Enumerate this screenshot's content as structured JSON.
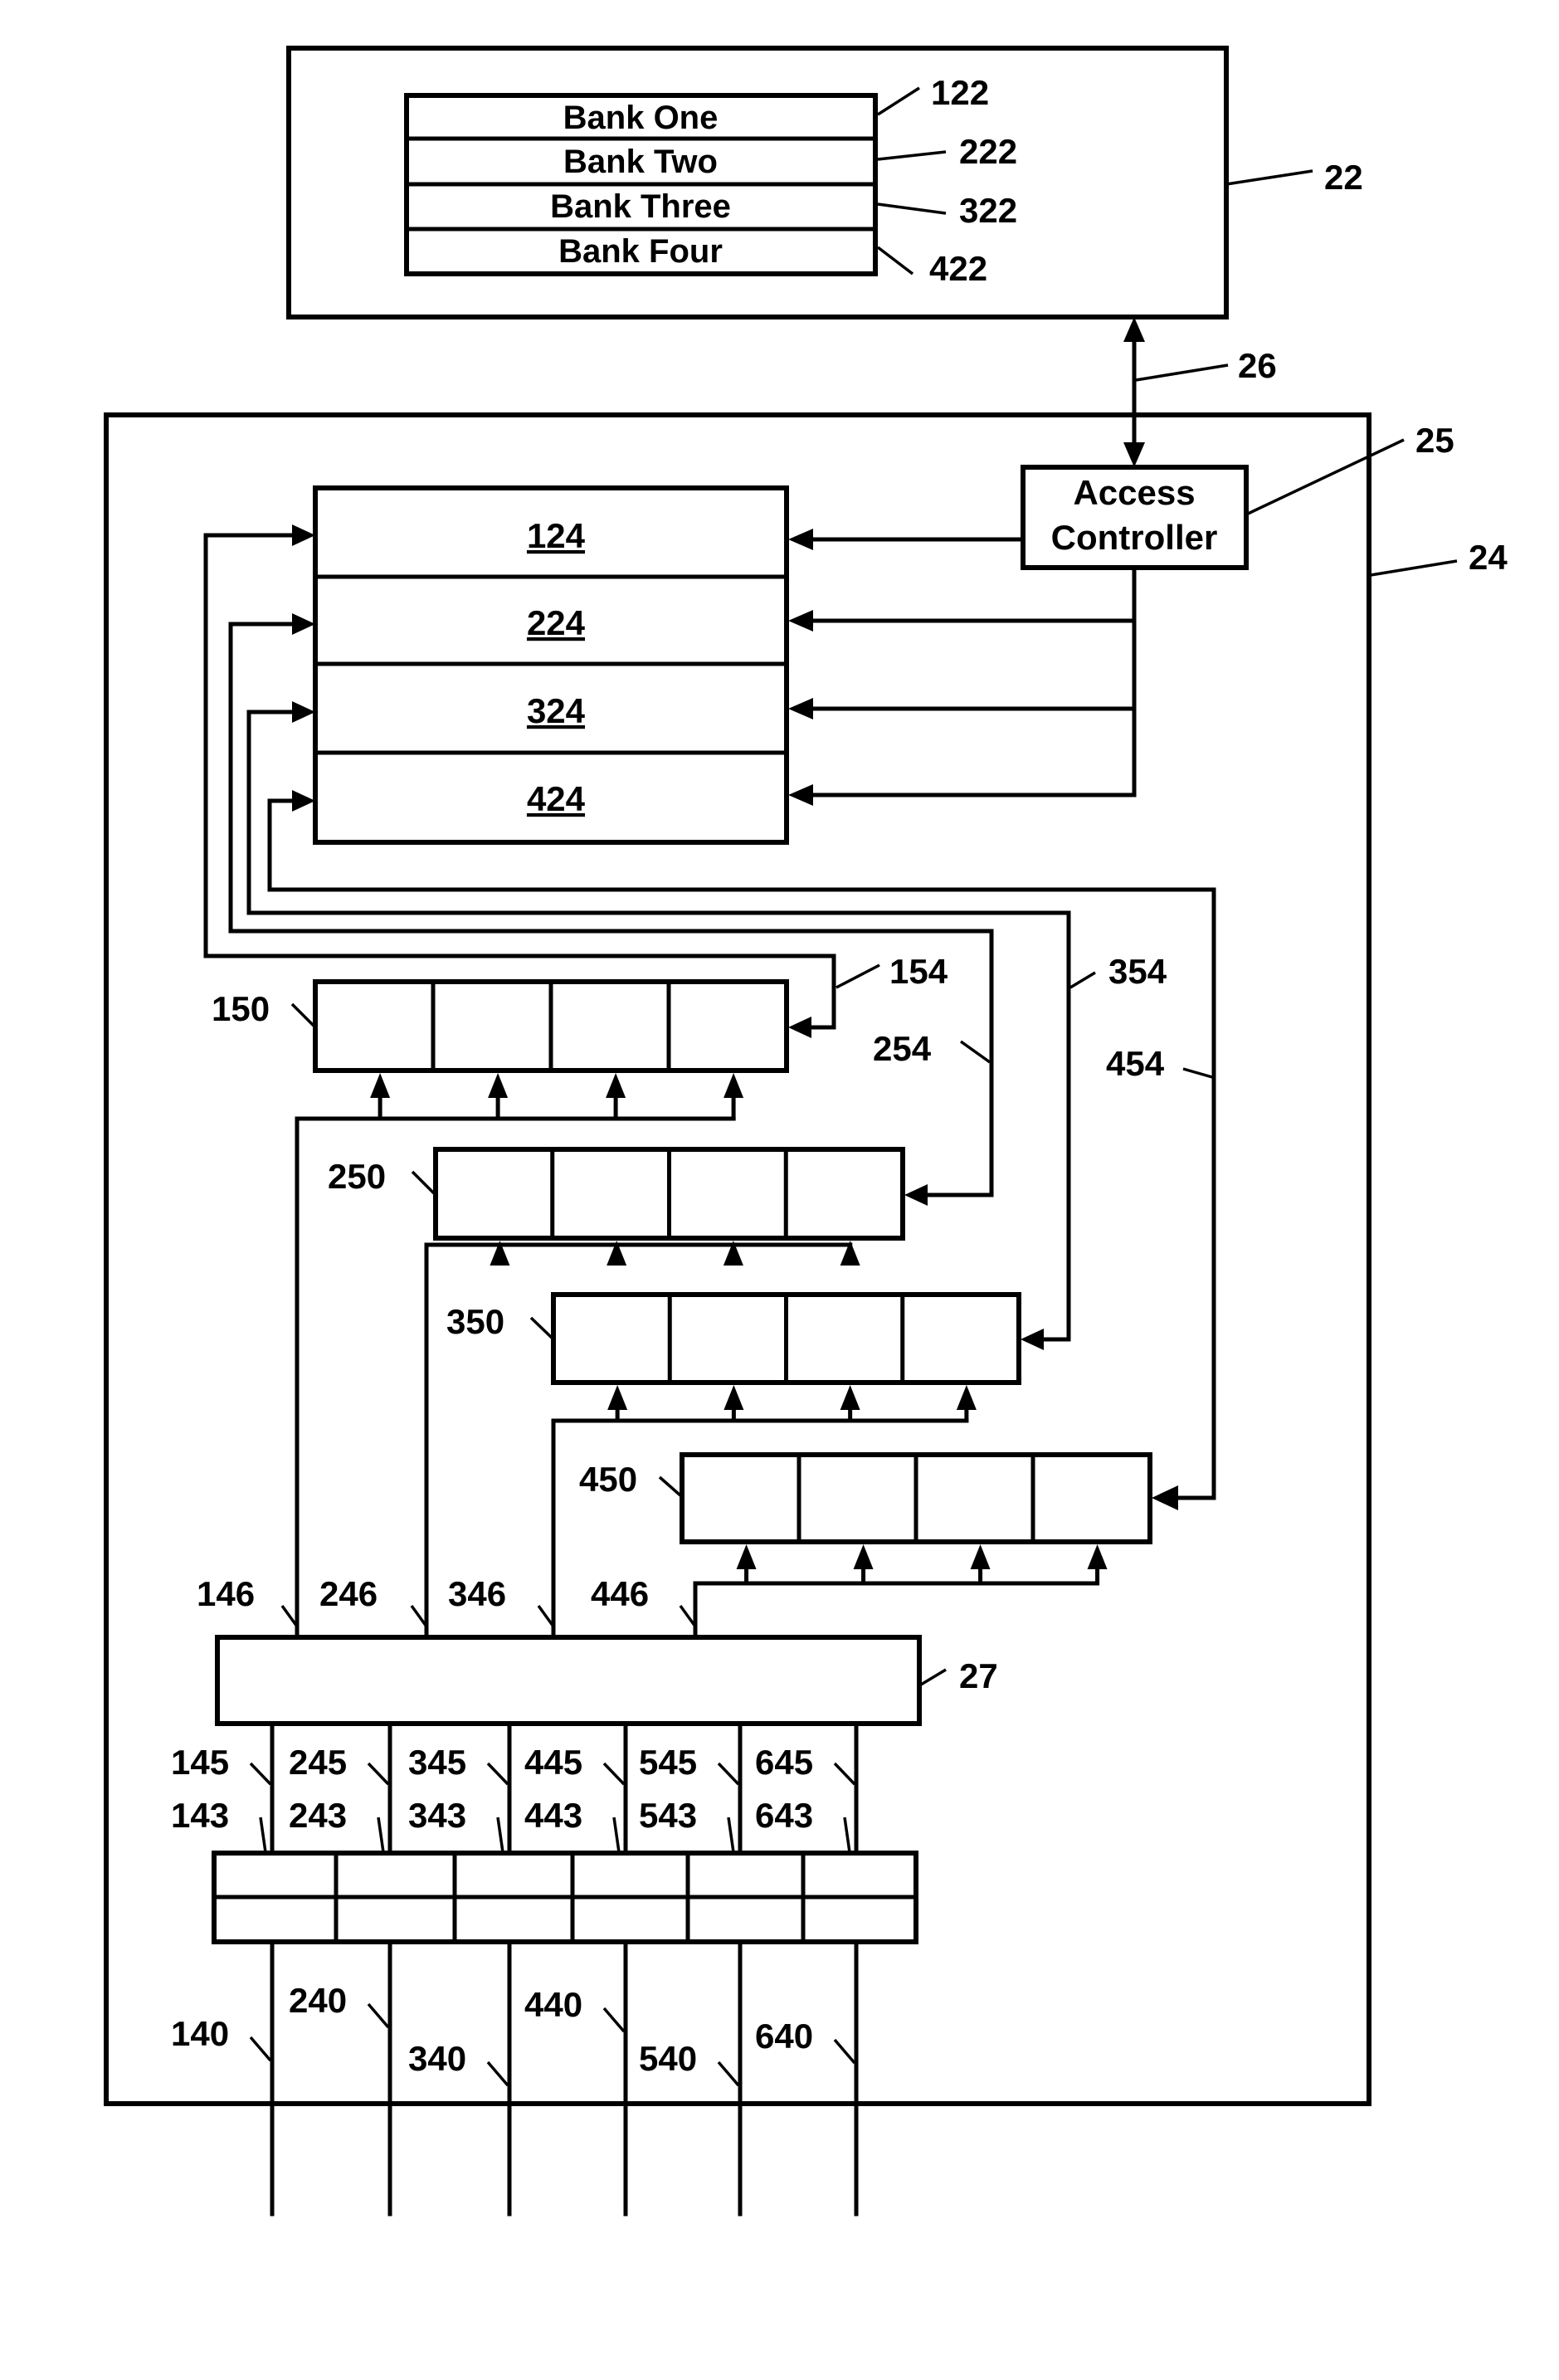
{
  "figure": {
    "memory_device": {
      "ref": "22",
      "banks": [
        {
          "label": "Bank One",
          "ref": "122"
        },
        {
          "label": "Bank Two",
          "ref": "222"
        },
        {
          "label": "Bank Three",
          "ref": "322"
        },
        {
          "label": "Bank Four",
          "ref": "422"
        }
      ]
    },
    "bus": {
      "ref": "26"
    },
    "controller_unit": {
      "ref": "24"
    },
    "access_controller": {
      "line1": "Access",
      "line2": "Controller",
      "ref": "25"
    },
    "cache_segments": [
      {
        "label": "124"
      },
      {
        "label": "224"
      },
      {
        "label": "324"
      },
      {
        "label": "424"
      }
    ],
    "buffers": [
      {
        "ref": "150",
        "feedback_ref": "154",
        "input_ref": "146"
      },
      {
        "ref": "250",
        "feedback_ref": "254",
        "input_ref": "246"
      },
      {
        "ref": "350",
        "feedback_ref": "354",
        "input_ref": "346"
      },
      {
        "ref": "450",
        "feedback_ref": "454",
        "input_ref": "446"
      }
    ],
    "switch": {
      "ref": "27"
    },
    "ports": [
      {
        "link_ref": "145",
        "port_ref": "143",
        "line_ref": "140"
      },
      {
        "link_ref": "245",
        "port_ref": "243",
        "line_ref": "240"
      },
      {
        "link_ref": "345",
        "port_ref": "343",
        "line_ref": "340"
      },
      {
        "link_ref": "445",
        "port_ref": "443",
        "line_ref": "440"
      },
      {
        "link_ref": "545",
        "port_ref": "543",
        "line_ref": "540"
      },
      {
        "link_ref": "645",
        "port_ref": "643",
        "line_ref": "640"
      }
    ]
  }
}
